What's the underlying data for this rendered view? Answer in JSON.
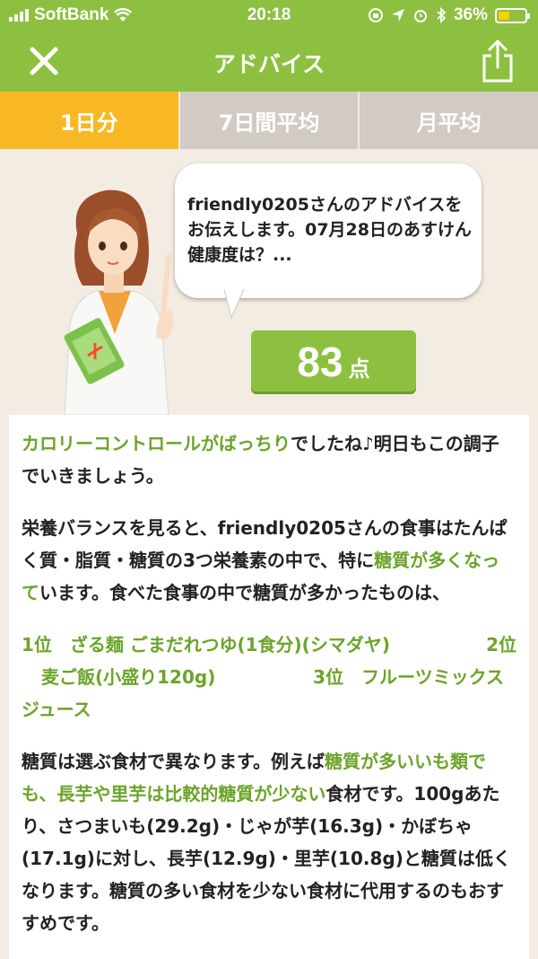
{
  "status_bar": {
    "carrier": "SoftBank",
    "time": "20:18",
    "battery": "36%"
  },
  "nav": {
    "title": "アドバイス"
  },
  "tabs": [
    {
      "label": "1日分",
      "active": true
    },
    {
      "label": "7日間平均",
      "active": false
    },
    {
      "label": "月平均",
      "active": false
    }
  ],
  "advisor": {
    "bubble_text": "friendly0205さんのアドバイスをお伝えします。07月28日のあすけん健康度は？...",
    "score": "83",
    "score_unit": "点"
  },
  "advice": {
    "p1_hl": "カロリーコントロールがばっちり",
    "p1_rest": "でしたね♪明日もこの調子でいきましょう。",
    "p2_a": "栄養バランスを見ると、friendly0205さんの食事はたんぱく質・脂質・糖質の3つ栄養素の中で、特に",
    "p2_hl": "糖質が多くなって",
    "p2_b": "います。食べた食事の中で糖質が多かったものは、",
    "ranking_line1": "1位　ざる麺 ごまだれつゆ(1食分)(シマダヤ)",
    "ranking_line1_right": "2位",
    "ranking_line2": "麦ご飯(小盛り120g)",
    "ranking_line2_right": "3位　フルーツミックス",
    "ranking_line3": "ジュース",
    "p3_a": "糖質は選ぶ食材で異なります。例えば",
    "p3_hl": "糖質が多いいも類でも、長芋や里芋は比較的糖質が少ない",
    "p3_b": "食材です。100gあたり、さつまいも(29.2g)・じゃが芋(16.3g)・かぼちゃ(17.1g)に対し、長芋(12.9g)・里芋(10.8g)と糖質は低くなります。糖質の多い食材を少ない食材に代用するのもおすすめです。"
  },
  "colors": {
    "brand_green": "#8dc040",
    "highlight_green": "#6ba42b",
    "active_tab": "#f7b824",
    "inactive_tab": "#d2cbc3"
  }
}
